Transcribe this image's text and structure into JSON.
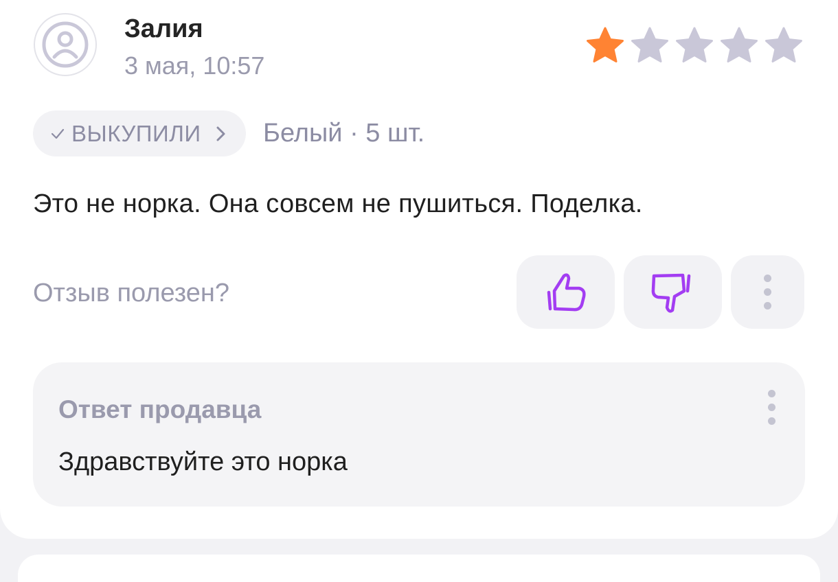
{
  "review": {
    "author": "Залия",
    "date": "3 мая, 10:57",
    "rating": 1,
    "max_rating": 5,
    "purchase_badge": "ВЫКУПИЛИ",
    "variant": "Белый · 5 шт.",
    "text": "Это не норка. Она совсем не пушиться. Поделка.",
    "helpful_question": "Отзыв полезен?"
  },
  "seller_reply": {
    "title": "Ответ продавца",
    "text": "Здравствуйте это норка"
  },
  "icons": {
    "avatar": "user-icon",
    "rating": "star-icon",
    "badge_check": "check-icon",
    "badge_arrow": "chevron-right-icon",
    "like": "thumbs-up-icon",
    "dislike": "thumbs-down-icon",
    "more": "more-vertical-icon"
  },
  "colors": {
    "star_filled": "#ff8333",
    "star_empty": "#c9c7d8",
    "accent": "#a33df2",
    "muted_text": "#9a9aad",
    "surface": "#f2f2f5"
  }
}
